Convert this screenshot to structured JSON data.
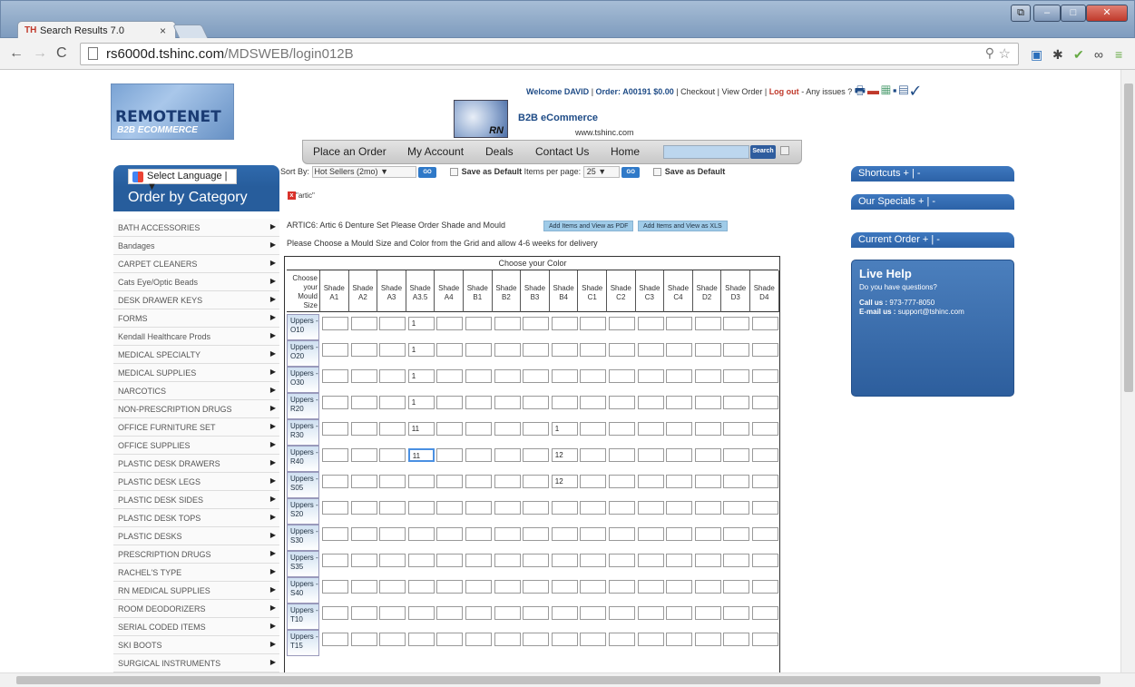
{
  "browser": {
    "tab_title": "Search Results 7.0",
    "tab_favicon": "TH",
    "url_host": "rs6000d.tshinc.com",
    "url_path": "/MDSWEB/login012B"
  },
  "header": {
    "welcome": "Welcome DAVID",
    "order": "Order: A00191 $0.00",
    "checkout": "Checkout",
    "view_order": "View Order",
    "logout": "Log out",
    "issues": "- Any issues ?",
    "logo_line1": "REMOTENET",
    "logo_line2": "B2B ECOMMERCE",
    "b2b_title": "B2B eCommerce",
    "b2b_url": "www.tshinc.com",
    "b2b_mark": "RN"
  },
  "menu": {
    "items": [
      "Place an Order",
      "My Account",
      "Deals",
      "Contact Us",
      "Home"
    ],
    "search_label": "Search"
  },
  "sidebar": {
    "language": "Select Language",
    "title": "Order by Category",
    "categories": [
      "BATH ACCESSORIES",
      "Bandages",
      "CARPET CLEANERS",
      "Cats Eye/Optic Beads",
      "DESK DRAWER KEYS",
      "FORMS",
      "Kendall Healthcare Prods",
      "MEDICAL SPECIALTY",
      "MEDICAL SUPPLIES",
      "NARCOTICS",
      "NON-PRESCRIPTION DRUGS",
      "OFFICE FURNITURE SET",
      "OFFICE SUPPLIES",
      "PLASTIC DESK DRAWERS",
      "PLASTIC DESK LEGS",
      "PLASTIC DESK SIDES",
      "PLASTIC DESK TOPS",
      "PLASTIC DESKS",
      "PRESCRIPTION DRUGS",
      "RACHEL'S TYPE",
      "RN MEDICAL SUPPLIES",
      "ROOM DEODORIZERS",
      "SERIAL CODED ITEMS",
      "SKI BOOTS",
      "SURGICAL INSTRUMENTS"
    ]
  },
  "sortbar": {
    "sort_label": "Sort By:",
    "sort_value": "Hot Sellers (2mo)",
    "go": "GO",
    "save_default": "Save as Default",
    "per_page_label": "Items per page:",
    "per_page_value": "25"
  },
  "filter": {
    "text": "\"artic\""
  },
  "product": {
    "line": "ARTIC6: Artic 6 Denture Set Please Order Shade and Mould",
    "btn_pdf": "Add Items and View as PDF",
    "btn_xls": "Add Items and View as XLS",
    "instructions": "Please Choose a Mould Size and Color from the Grid and allow 4-6 weeks for delivery"
  },
  "grid": {
    "title": "Choose your Color",
    "corner": [
      "Choose",
      "your",
      "Mould",
      "Size"
    ],
    "shades": [
      "A1",
      "A2",
      "A3",
      "A3.5",
      "A4",
      "B1",
      "B2",
      "B3",
      "B4",
      "C1",
      "C2",
      "C3",
      "C4",
      "D2",
      "D3",
      "D4"
    ],
    "rows": [
      {
        "label": "Uppers - O10",
        "cells": {
          "3": "1"
        }
      },
      {
        "label": "Uppers - O20",
        "cells": {
          "3": "1"
        }
      },
      {
        "label": "Uppers - O30",
        "cells": {
          "3": "1"
        }
      },
      {
        "label": "Uppers - R20",
        "cells": {
          "3": "1"
        }
      },
      {
        "label": "Uppers - R30",
        "cells": {
          "3": "11",
          "8": "1"
        }
      },
      {
        "label": "Uppers - R40",
        "cells": {
          "3": "11",
          "8": "12"
        },
        "selected": 3
      },
      {
        "label": "Uppers - S05",
        "cells": {
          "8": "12"
        }
      },
      {
        "label": "Uppers - S20",
        "cells": {}
      },
      {
        "label": "Uppers - S30",
        "cells": {}
      },
      {
        "label": "Uppers - S35",
        "cells": {}
      },
      {
        "label": "Uppers - S40",
        "cells": {}
      },
      {
        "label": "Uppers - T10",
        "cells": {}
      },
      {
        "label": "Uppers - T15",
        "cells": {}
      }
    ]
  },
  "right": {
    "shortcuts": "Shortcuts + | -",
    "specials": "Our Specials + | -",
    "current_order": "Current Order + | -",
    "live_help_title": "Live Help",
    "live_help_q": "Do you have questions?",
    "call_label": "Call us :",
    "call_value": "973-777-8050",
    "email_label": "E-mail us :",
    "email_value": "support@tshinc.com"
  }
}
